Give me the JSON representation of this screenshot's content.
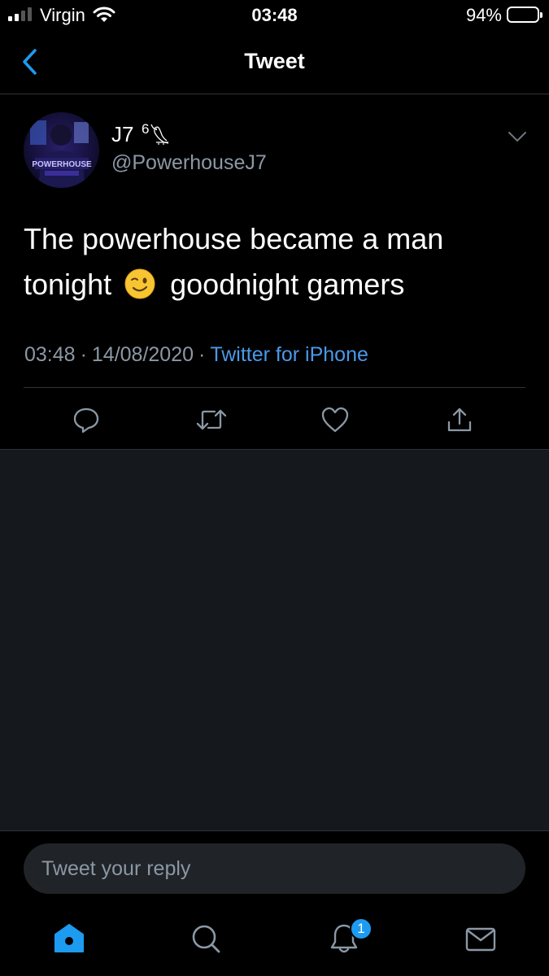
{
  "status_bar": {
    "carrier": "Virgin",
    "time": "03:48",
    "battery_percent": "94%",
    "battery_level": 0.94,
    "signal_bars": 2
  },
  "nav": {
    "title": "Tweet",
    "back_icon": "chevron-left-icon"
  },
  "tweet": {
    "author": {
      "display_name": "J7",
      "name_suffix": "6",
      "name_emblem_icon": "owl-icon",
      "handle": "@PowerhouseJ7",
      "avatar_text": "POWERHOUSE"
    },
    "text_before_emoji": "The powerhouse became a man tonight",
    "emoji": "winking-face-icon",
    "text_after_emoji": "goodnight gamers",
    "time": "03:48",
    "date": "14/08/2020",
    "separator": "·",
    "source": "Twitter for iPhone",
    "actions": [
      "reply-icon",
      "retweet-icon",
      "like-icon",
      "share-icon"
    ]
  },
  "reply": {
    "placeholder": "Tweet your reply"
  },
  "tab_bar": {
    "tabs": [
      "home-icon",
      "search-icon",
      "notifications-icon",
      "messages-icon"
    ],
    "notification_count": "1"
  },
  "colors": {
    "accent": "#1d9bf0",
    "link": "#4a99e9",
    "secondary_text": "#8b98a5",
    "background": "#000000",
    "empty_area": "#15181c"
  }
}
